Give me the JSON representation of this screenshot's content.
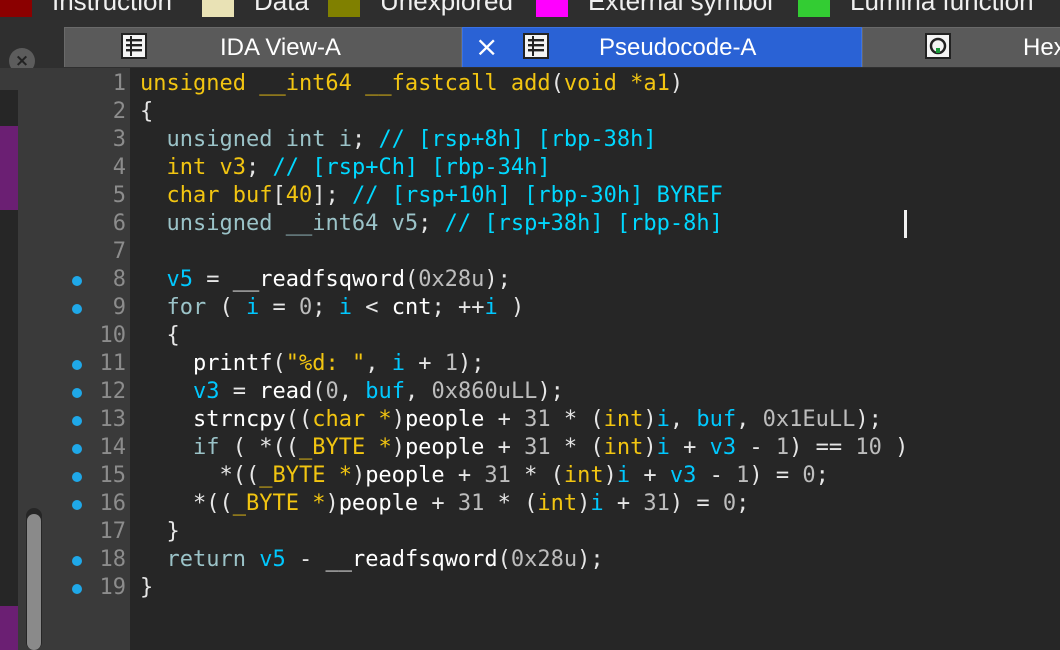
{
  "legend": [
    {
      "label": "Instruction",
      "color": "#8b0000"
    },
    {
      "label": "Data",
      "color": "#e9e2b5"
    },
    {
      "label": "Unexplored",
      "color": "#808000"
    },
    {
      "label": "External symbol",
      "color": "#ff00ff"
    },
    {
      "label": "Lumina function",
      "color": "#33cc33"
    }
  ],
  "tabs": [
    {
      "label": "IDA View-A",
      "icon": "listing-icon",
      "active": false
    },
    {
      "label": "Pseudocode-A",
      "icon": "listing-icon",
      "active": true,
      "close": "×"
    },
    {
      "label": "Hex",
      "icon": "hex-view-icon",
      "active": false
    }
  ],
  "close_panel_glyph": "×",
  "colors": {
    "accent_tab": "#2a62d5",
    "keyword": "#f2c511",
    "variable": "#00c8ff",
    "breakpoint_dot": "#1fa8e8"
  },
  "code_lines": [
    {
      "n": "1",
      "bp": false,
      "tokens": [
        [
          "unsigned __int64 __fastcall ",
          "kw"
        ],
        [
          "add",
          "kw"
        ],
        [
          "(",
          "pl"
        ],
        [
          "void *",
          "kw"
        ],
        [
          "a1",
          "kw"
        ],
        [
          ")",
          "pl"
        ]
      ]
    },
    {
      "n": "2",
      "bp": false,
      "tokens": [
        [
          "{",
          "pl"
        ]
      ]
    },
    {
      "n": "3",
      "bp": false,
      "tokens": [
        [
          "  ",
          "pl"
        ],
        [
          "unsigned int ",
          "ty"
        ],
        [
          "i",
          "ty"
        ],
        [
          "; ",
          "pl"
        ],
        [
          "// [rsp+8h] [rbp-38h]",
          "cm"
        ]
      ]
    },
    {
      "n": "4",
      "bp": false,
      "tokens": [
        [
          "  ",
          "pl"
        ],
        [
          "int ",
          "kw"
        ],
        [
          "v3",
          "kw"
        ],
        [
          "; ",
          "pl"
        ],
        [
          "// [rsp+Ch] [rbp-34h]",
          "cm"
        ]
      ]
    },
    {
      "n": "5",
      "bp": false,
      "tokens": [
        [
          "  ",
          "pl"
        ],
        [
          "char ",
          "kw"
        ],
        [
          "buf",
          "kw"
        ],
        [
          "[",
          "pl"
        ],
        [
          "40",
          "kw"
        ],
        [
          "]; ",
          "pl"
        ],
        [
          "// [rsp+10h] [rbp-30h] BYREF",
          "cm"
        ]
      ]
    },
    {
      "n": "6",
      "bp": false,
      "tokens": [
        [
          "  ",
          "pl"
        ],
        [
          "unsigned __int64 ",
          "ty"
        ],
        [
          "v5",
          "ty"
        ],
        [
          "; ",
          "pl"
        ],
        [
          "// [rsp+38h] [rbp-8h]",
          "cm"
        ]
      ]
    },
    {
      "n": "7",
      "bp": false,
      "tokens": []
    },
    {
      "n": "8",
      "bp": true,
      "tokens": [
        [
          "  ",
          "pl"
        ],
        [
          "v5",
          "var"
        ],
        [
          " = ",
          "pl"
        ],
        [
          "__readfsqword",
          "id"
        ],
        [
          "(",
          "pl"
        ],
        [
          "0x28u",
          "nm"
        ],
        [
          ");",
          "pl"
        ]
      ]
    },
    {
      "n": "9",
      "bp": true,
      "tokens": [
        [
          "  ",
          "pl"
        ],
        [
          "for",
          "ty"
        ],
        [
          " ( ",
          "pl"
        ],
        [
          "i",
          "var"
        ],
        [
          " = ",
          "pl"
        ],
        [
          "0",
          "nm"
        ],
        [
          "; ",
          "pl"
        ],
        [
          "i",
          "var"
        ],
        [
          " < ",
          "pl"
        ],
        [
          "cnt",
          "id"
        ],
        [
          "; ++",
          "pl"
        ],
        [
          "i",
          "var"
        ],
        [
          " )",
          "pl"
        ]
      ]
    },
    {
      "n": "10",
      "bp": false,
      "tokens": [
        [
          "  ",
          "pl"
        ],
        [
          "{",
          "pl"
        ]
      ]
    },
    {
      "n": "11",
      "bp": true,
      "tokens": [
        [
          "    ",
          "pl"
        ],
        [
          "printf",
          "id"
        ],
        [
          "(",
          "pl"
        ],
        [
          "\"%d: \"",
          "st"
        ],
        [
          ", ",
          "pl"
        ],
        [
          "i",
          "var"
        ],
        [
          " + ",
          "pl"
        ],
        [
          "1",
          "nm"
        ],
        [
          ");",
          "pl"
        ]
      ]
    },
    {
      "n": "12",
      "bp": true,
      "tokens": [
        [
          "    ",
          "pl"
        ],
        [
          "v3",
          "var"
        ],
        [
          " = ",
          "pl"
        ],
        [
          "read",
          "id"
        ],
        [
          "(",
          "pl"
        ],
        [
          "0",
          "nm"
        ],
        [
          ", ",
          "pl"
        ],
        [
          "buf",
          "var"
        ],
        [
          ", ",
          "pl"
        ],
        [
          "0x860uLL",
          "nm"
        ],
        [
          ");",
          "pl"
        ]
      ]
    },
    {
      "n": "13",
      "bp": true,
      "tokens": [
        [
          "    ",
          "pl"
        ],
        [
          "strncpy",
          "id"
        ],
        [
          "((",
          "pl"
        ],
        [
          "char *",
          "kw"
        ],
        [
          ")",
          "pl"
        ],
        [
          "people",
          "id"
        ],
        [
          " + ",
          "pl"
        ],
        [
          "31",
          "nm"
        ],
        [
          " * (",
          "pl"
        ],
        [
          "int",
          "kw"
        ],
        [
          ")",
          "pl"
        ],
        [
          "i",
          "var"
        ],
        [
          ", ",
          "pl"
        ],
        [
          "buf",
          "var"
        ],
        [
          ", ",
          "pl"
        ],
        [
          "0x1EuLL",
          "nm"
        ],
        [
          ");",
          "pl"
        ]
      ]
    },
    {
      "n": "14",
      "bp": true,
      "tokens": [
        [
          "    ",
          "pl"
        ],
        [
          "if",
          "ty"
        ],
        [
          " ( *((",
          "pl"
        ],
        [
          "_BYTE *",
          "kw"
        ],
        [
          ")",
          "pl"
        ],
        [
          "people",
          "id"
        ],
        [
          " + ",
          "pl"
        ],
        [
          "31",
          "nm"
        ],
        [
          " * (",
          "pl"
        ],
        [
          "int",
          "kw"
        ],
        [
          ")",
          "pl"
        ],
        [
          "i",
          "var"
        ],
        [
          " + ",
          "pl"
        ],
        [
          "v3",
          "var"
        ],
        [
          " - ",
          "pl"
        ],
        [
          "1",
          "nm"
        ],
        [
          ") == ",
          "pl"
        ],
        [
          "10",
          "nm"
        ],
        [
          " )",
          "pl"
        ]
      ]
    },
    {
      "n": "15",
      "bp": true,
      "tokens": [
        [
          "      *((",
          "pl"
        ],
        [
          "_BYTE *",
          "kw"
        ],
        [
          ")",
          "pl"
        ],
        [
          "people",
          "id"
        ],
        [
          " + ",
          "pl"
        ],
        [
          "31",
          "nm"
        ],
        [
          " * (",
          "pl"
        ],
        [
          "int",
          "kw"
        ],
        [
          ")",
          "pl"
        ],
        [
          "i",
          "var"
        ],
        [
          " + ",
          "pl"
        ],
        [
          "v3",
          "var"
        ],
        [
          " - ",
          "pl"
        ],
        [
          "1",
          "nm"
        ],
        [
          ") = ",
          "pl"
        ],
        [
          "0",
          "nm"
        ],
        [
          ";",
          "pl"
        ]
      ]
    },
    {
      "n": "16",
      "bp": true,
      "tokens": [
        [
          "    *((",
          "pl"
        ],
        [
          "_BYTE *",
          "kw"
        ],
        [
          ")",
          "pl"
        ],
        [
          "people",
          "id"
        ],
        [
          " + ",
          "pl"
        ],
        [
          "31",
          "nm"
        ],
        [
          " * (",
          "pl"
        ],
        [
          "int",
          "kw"
        ],
        [
          ")",
          "pl"
        ],
        [
          "i",
          "var"
        ],
        [
          " + ",
          "pl"
        ],
        [
          "31",
          "nm"
        ],
        [
          ") = ",
          "pl"
        ],
        [
          "0",
          "nm"
        ],
        [
          ";",
          "pl"
        ]
      ]
    },
    {
      "n": "17",
      "bp": false,
      "tokens": [
        [
          "  ",
          "pl"
        ],
        [
          "}",
          "pl"
        ]
      ]
    },
    {
      "n": "18",
      "bp": true,
      "tokens": [
        [
          "  ",
          "pl"
        ],
        [
          "return",
          "ty"
        ],
        [
          " ",
          "pl"
        ],
        [
          "v5",
          "var"
        ],
        [
          " - ",
          "pl"
        ],
        [
          "__readfsqword",
          "id"
        ],
        [
          "(",
          "pl"
        ],
        [
          "0x28u",
          "nm"
        ],
        [
          ");",
          "pl"
        ]
      ]
    },
    {
      "n": "19",
      "bp": true,
      "tokens": [
        [
          "}",
          "pl"
        ]
      ]
    }
  ]
}
